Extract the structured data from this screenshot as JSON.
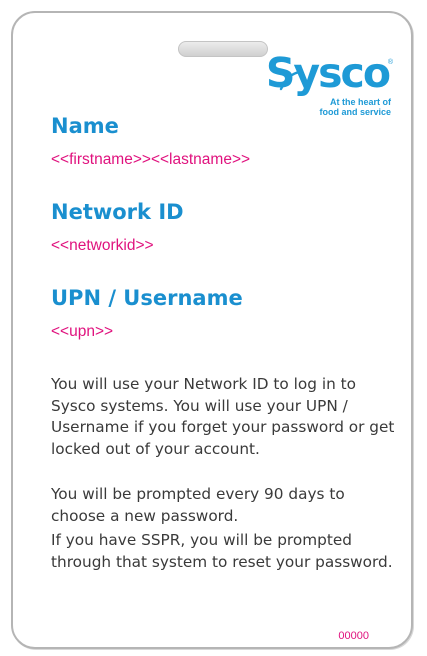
{
  "brand": {
    "name": "Sysco",
    "registered": "®",
    "tagline_line1": "At the heart of",
    "tagline_line2": "food and service"
  },
  "fields": {
    "name": {
      "label": "Name",
      "value": "<<firstname>><<lastname>>"
    },
    "network_id": {
      "label": "Network ID",
      "value": "<<networkid>>"
    },
    "upn": {
      "label": "UPN / Username",
      "value": "<<upn>>"
    }
  },
  "instructions": {
    "p1": "You will use your Network ID to log in to Sysco systems. You will use your UPN / Username if you forget your password or get locked out of your account.",
    "p2": "You will be prompted every 90 days to choose a new password.",
    "p3": "If you have SSPR, you will be prompted through that system to reset your password."
  },
  "serial": "00000",
  "colors": {
    "brand_blue": "#1a8fcf",
    "placeholder_pink": "#e0127e",
    "body_text": "#3a3a3a",
    "border": "#b5b5b5"
  }
}
